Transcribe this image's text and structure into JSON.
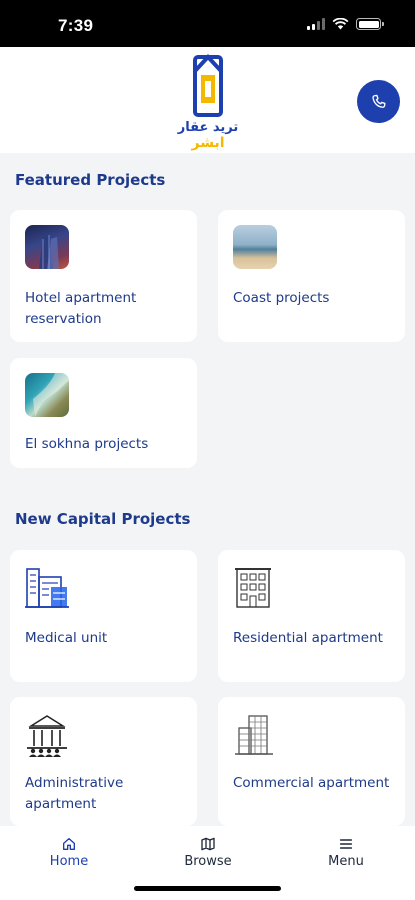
{
  "status_bar": {
    "time": "7:39"
  },
  "header": {
    "logo_text_line1": "تريد عقار",
    "logo_text_line2": "ابشر",
    "call_icon": "phone-icon"
  },
  "featured": {
    "title": "Featured Projects",
    "items": [
      {
        "label": "Hotel apartment reservation",
        "image": "hotel-building-photo"
      },
      {
        "label": "Coast projects",
        "image": "beach-photo"
      },
      {
        "label": "El sokhna projects",
        "image": "coastline-aerial-photo"
      }
    ]
  },
  "capital": {
    "title": "New Capital Projects",
    "items": [
      {
        "label": "Medical unit",
        "icon": "hospital-building-icon"
      },
      {
        "label": "Residential apartment",
        "icon": "residential-building-icon"
      },
      {
        "label": "Administrative apartment",
        "icon": "administrative-building-icon"
      },
      {
        "label": "Commercial apartment",
        "icon": "commercial-building-icon"
      }
    ]
  },
  "nav": {
    "items": [
      {
        "label": "Home",
        "icon": "home-icon"
      },
      {
        "label": "Browse",
        "icon": "map-icon"
      },
      {
        "label": "Menu",
        "icon": "menu-icon"
      }
    ]
  },
  "colors": {
    "primary": "#1e40af",
    "accent": "#f5b800",
    "background": "#f3f4f6"
  }
}
